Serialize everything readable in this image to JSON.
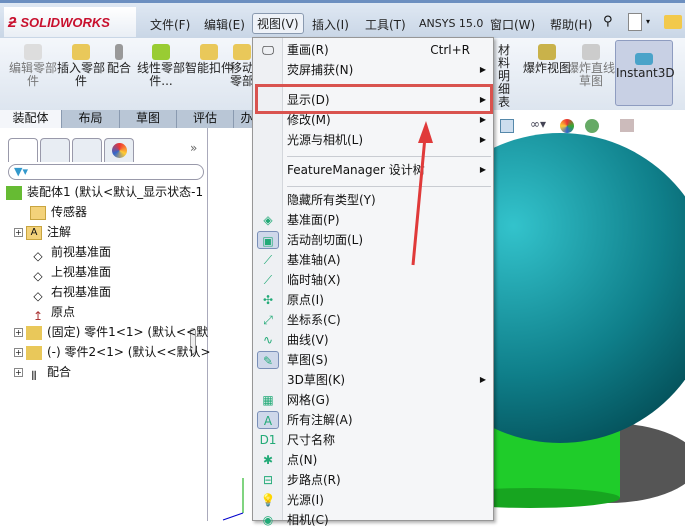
{
  "app": {
    "logo": "SOLIDWORKS"
  },
  "menubar": [
    "文件(F)",
    "编辑(E)",
    "视图(V)",
    "插入(I)",
    "工具(T)",
    "ANSYS 15.0",
    "窗口(W)",
    "帮助(H)"
  ],
  "toolbar": [
    {
      "label": "编辑零部件",
      "disabled": true
    },
    {
      "label": "插入零部件"
    },
    {
      "label": "配合"
    },
    {
      "label": "线性零部件..."
    },
    {
      "label": "智能扣件"
    },
    {
      "label": "移动零部"
    },
    {
      "label": "材料明细表"
    },
    {
      "label": "爆炸视图"
    },
    {
      "label": "爆炸直线草图",
      "disabled": true
    },
    {
      "label": "Instant3D"
    }
  ],
  "tabs": [
    "装配体",
    "布局",
    "草图",
    "评估",
    "办"
  ],
  "tree": [
    {
      "label": "装配体1  (默认<默认_显示状态-1"
    },
    {
      "label": "传感器"
    },
    {
      "label": "注解"
    },
    {
      "label": "前视基准面"
    },
    {
      "label": "上视基准面"
    },
    {
      "label": "右视基准面"
    },
    {
      "label": "原点"
    },
    {
      "label": "(固定) 零件1<1> (默认<<默"
    },
    {
      "label": "(-) 零件2<1> (默认<<默认>"
    },
    {
      "label": "配合"
    }
  ],
  "view_menu": {
    "redraw": {
      "label": "重画(R)",
      "shortcut": "Ctrl+R"
    },
    "items_top": [
      "荧屏捕获(N)",
      "显示(D)",
      "修改(M)",
      "光源与相机(L)"
    ],
    "feature_manager": "FeatureManager 设计树",
    "items": [
      "隐藏所有类型(Y)",
      "基准面(P)",
      "活动剖切面(L)",
      "基准轴(A)",
      "临时轴(X)",
      "原点(I)",
      "坐标系(C)",
      "曲线(V)",
      "草图(S)",
      "3D草图(K)",
      "网格(G)",
      "所有注解(A)",
      "尺寸名称",
      "点(N)",
      "步路点(R)",
      "光源(I)",
      "相机(C)"
    ]
  },
  "colors": {
    "highlight": "#d9534f",
    "arrow": "#e03a3a",
    "sphere": "#0f7f8a",
    "cylinder": "#1fcc2a"
  }
}
